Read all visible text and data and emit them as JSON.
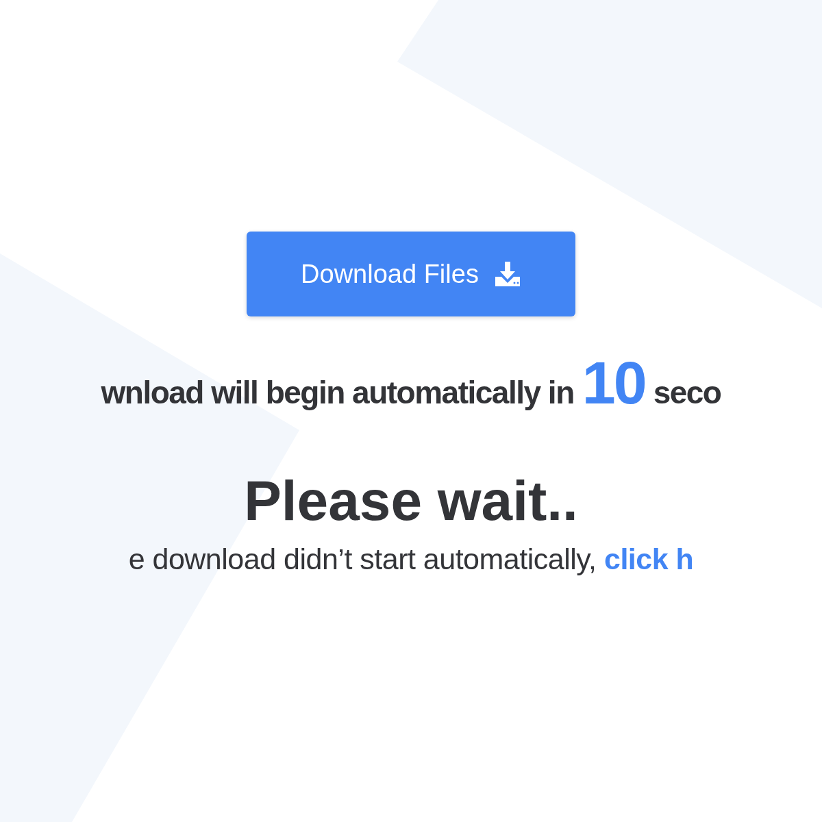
{
  "download_button": {
    "label": "Download Files"
  },
  "countdown": {
    "before": "wnload will begin automatically in",
    "seconds": "10",
    "after": "seco"
  },
  "heading": "Please wait..",
  "fallback": {
    "text": "e download didn’t start automatically,",
    "link": "click h"
  }
}
